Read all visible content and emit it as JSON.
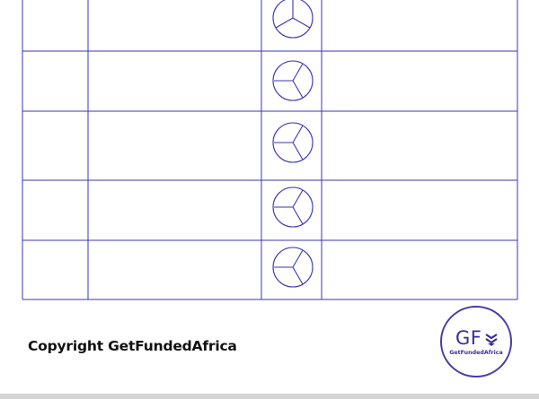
{
  "footer": {
    "copyright": "Copyright GetFundedAfrica"
  },
  "logo": {
    "mark": "GF",
    "name": "GetFundedAfrica",
    "icon": "layered-chevron-icon"
  },
  "table": {
    "rows": [
      {
        "cells": [
          "",
          "",
          "pie-chart-icon",
          ""
        ]
      },
      {
        "cells": [
          "",
          "",
          "pie-chart-icon",
          ""
        ]
      },
      {
        "cells": [
          "",
          "",
          "pie-chart-icon",
          ""
        ]
      },
      {
        "cells": [
          "",
          "",
          "pie-chart-icon",
          ""
        ]
      },
      {
        "cells": [
          "",
          "",
          "pie-chart-icon",
          ""
        ]
      }
    ]
  },
  "colors": {
    "line": "#3a35b8",
    "brand": "#3b2f92",
    "text": "#111111"
  }
}
